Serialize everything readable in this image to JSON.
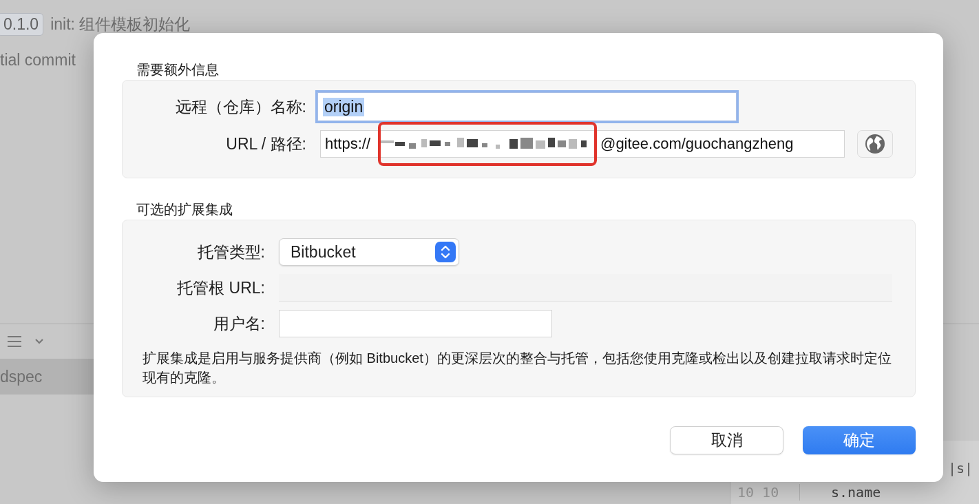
{
  "background": {
    "commits": [
      {
        "tag": "0.1.0",
        "message": "init: 组件模板初始化"
      },
      {
        "message": "tial commit"
      }
    ],
    "file_item": {
      "label": "dspec",
      "selected": true
    },
    "code": {
      "top_text": "|s|",
      "line_numbers": [
        "10",
        "10"
      ],
      "line": "s.name"
    }
  },
  "dialog": {
    "sections": [
      {
        "title": "需要额外信息",
        "fields": [
          {
            "kind": "text",
            "label": "远程（仓库）名称:",
            "value": "origin",
            "focused": true,
            "value_selected": true
          },
          {
            "kind": "url",
            "label": "URL / 路径:",
            "prefix": "https://",
            "suffix": "@gitee.com/guochangzheng",
            "redacted": true,
            "highlighted": true
          }
        ]
      },
      {
        "title": "可选的扩展集成",
        "fields": [
          {
            "kind": "popup",
            "label": "托管类型:",
            "value": "Bitbucket"
          },
          {
            "kind": "text",
            "label": "托管根 URL:",
            "disabled": true
          },
          {
            "kind": "text",
            "label": "用户名:",
            "short": true
          }
        ],
        "note": "扩展集成是启用与服务提供商（例如 Bitbucket）的更深层次的整合与托管，包括您使用克隆或检出以及创建拉取请求时定位现有的克隆。"
      }
    ],
    "buttons": [
      {
        "label": "取消",
        "kind": "default"
      },
      {
        "label": "确定",
        "kind": "primary"
      }
    ]
  }
}
